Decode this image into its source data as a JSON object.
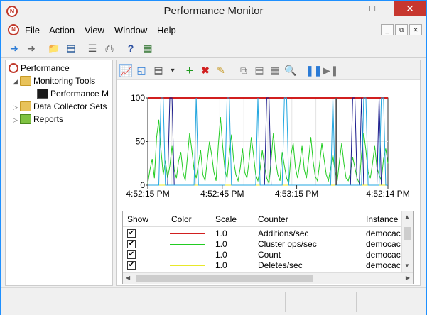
{
  "window": {
    "title": "Performance Monitor"
  },
  "menu": [
    "File",
    "Action",
    "View",
    "Window",
    "Help"
  ],
  "tree": [
    {
      "label": "Performance"
    },
    {
      "label": "Monitoring Tools"
    },
    {
      "label": "Performance M"
    },
    {
      "label": "Data Collector Sets"
    },
    {
      "label": "Reports"
    }
  ],
  "chart": {
    "yticks": [
      "100",
      "50",
      "0"
    ],
    "xticks": [
      "4:52:15 PM",
      "4:52:45 PM",
      "4:53:15 PM",
      "4:52:14 PM"
    ]
  },
  "chart_data": {
    "type": "line",
    "ylim": [
      0,
      100
    ],
    "yticks": [
      0,
      50,
      100
    ],
    "xticks": [
      "4:52:15 PM",
      "4:52:45 PM",
      "4:53:15 PM",
      "4:52:14 PM"
    ],
    "series": [
      {
        "name": "Additions/sec",
        "color": "#d11f1f",
        "values": [
          100,
          100,
          100,
          100,
          100,
          100,
          100,
          100,
          100,
          100,
          100,
          100,
          100,
          100,
          100,
          100,
          100,
          100,
          100,
          100,
          100,
          100,
          100,
          100,
          100,
          100,
          100,
          100,
          100,
          100,
          100,
          100,
          100,
          100,
          100,
          100,
          100,
          100,
          100,
          100,
          100,
          100,
          100,
          100,
          100,
          100,
          100,
          100,
          100,
          100,
          100,
          100,
          100,
          100,
          100,
          100,
          100,
          100,
          100,
          100,
          100,
          100,
          100,
          100,
          100,
          100,
          100,
          100,
          100,
          100,
          100,
          100,
          100,
          100,
          100,
          100,
          100,
          100,
          100,
          100,
          100,
          100,
          100,
          100,
          100,
          100,
          100,
          100,
          100,
          100,
          100,
          100,
          100,
          100,
          100,
          100,
          100,
          100,
          100,
          100,
          100,
          100,
          100,
          100,
          100,
          100,
          100,
          100,
          100,
          100
        ]
      },
      {
        "name": "Cluster ops/sec",
        "color": "#22cc22",
        "values": [
          2,
          18,
          30,
          8,
          55,
          75,
          40,
          12,
          28,
          8,
          22,
          45,
          18,
          8,
          28,
          38,
          15,
          5,
          32,
          60,
          40,
          18,
          8,
          25,
          40,
          12,
          5,
          28,
          50,
          35,
          15,
          5,
          45,
          78,
          45,
          18,
          8,
          35,
          58,
          28,
          12,
          5,
          20,
          42,
          15,
          8,
          28,
          55,
          35,
          12,
          5,
          18,
          40,
          22,
          8,
          2,
          30,
          60,
          28,
          12,
          5,
          38,
          22,
          8,
          2,
          35,
          48,
          20,
          8,
          25,
          45,
          18,
          8,
          30,
          55,
          28,
          10,
          5,
          25,
          48,
          30,
          12,
          5,
          20,
          35,
          15,
          5,
          28,
          48,
          25,
          8,
          5,
          15,
          32,
          20,
          8,
          2,
          35,
          60,
          40,
          15,
          8,
          25,
          45,
          20,
          12,
          5,
          30,
          42,
          25
        ]
      },
      {
        "name": "Count",
        "color": "#1a1a8c",
        "values": [
          0,
          0,
          0,
          0,
          0,
          0,
          0,
          0,
          0,
          0,
          100,
          100,
          0,
          0,
          0,
          0,
          0,
          0,
          0,
          0,
          0,
          0,
          0,
          0,
          0,
          0,
          0,
          0,
          0,
          0,
          0,
          0,
          0,
          0,
          0,
          0,
          0,
          0,
          0,
          0,
          0,
          0,
          0,
          0,
          0,
          0,
          0,
          0,
          0,
          0,
          0,
          0,
          0,
          0,
          100,
          100,
          0,
          0,
          0,
          0,
          0,
          0,
          0,
          0,
          0,
          0,
          0,
          0,
          0,
          0,
          0,
          0,
          0,
          0,
          0,
          0,
          0,
          0,
          0,
          0,
          0,
          0,
          0,
          0,
          0,
          0,
          0,
          0,
          0,
          0,
          0,
          0,
          0,
          100,
          100,
          0,
          0,
          100,
          0,
          0,
          0,
          0,
          0,
          0,
          0,
          100,
          0,
          0,
          0,
          0
        ]
      },
      {
        "name": "Deletes/sec",
        "color": "#e8e82a",
        "values": [
          0,
          0,
          0,
          0,
          0,
          0,
          0,
          0,
          0,
          0,
          0,
          0,
          0,
          0,
          0,
          0,
          0,
          0,
          0,
          0,
          0,
          0,
          0,
          0,
          0,
          0,
          0,
          0,
          0,
          0,
          0,
          0,
          0,
          0,
          0,
          0,
          0,
          0,
          0,
          0,
          0,
          0,
          0,
          0,
          0,
          0,
          0,
          0,
          0,
          0,
          0,
          0,
          0,
          0,
          0,
          0,
          0,
          0,
          0,
          0,
          0,
          0,
          0,
          0,
          0,
          0,
          0,
          0,
          0,
          0,
          0,
          0,
          0,
          0,
          0,
          0,
          0,
          0,
          0,
          0,
          0,
          0,
          0,
          0,
          0,
          0,
          0,
          0,
          0,
          0,
          0,
          0,
          0,
          0,
          0,
          0,
          0,
          0,
          0,
          0,
          0,
          0,
          0,
          0,
          0,
          0,
          0,
          0,
          0,
          0
        ]
      },
      {
        "name": "Instance",
        "color": "#23a7e0",
        "values": [
          0,
          0,
          0,
          0,
          0,
          0,
          100,
          100,
          0,
          0,
          0,
          0,
          0,
          0,
          0,
          0,
          0,
          0,
          0,
          0,
          0,
          0,
          100,
          0,
          0,
          0,
          0,
          0,
          0,
          0,
          0,
          0,
          0,
          0,
          0,
          0,
          100,
          100,
          0,
          0,
          0,
          0,
          0,
          0,
          0,
          0,
          0,
          0,
          0,
          0,
          100,
          0,
          0,
          0,
          0,
          0,
          0,
          0,
          0,
          0,
          0,
          0,
          100,
          100,
          0,
          0,
          0,
          0,
          0,
          0,
          0,
          0,
          0,
          0,
          0,
          0,
          0,
          0,
          0,
          0,
          0,
          0,
          0,
          0,
          100,
          0,
          0,
          0,
          0,
          0,
          0,
          0,
          0,
          0,
          0,
          0,
          0,
          0,
          100,
          100,
          0,
          0,
          0,
          0,
          0,
          0,
          100,
          100,
          0,
          0
        ]
      }
    ]
  },
  "legend": {
    "headers": {
      "show": "Show",
      "color": "Color",
      "scale": "Scale",
      "counter": "Counter",
      "instance": "Instance"
    },
    "rows": [
      {
        "show": "✔",
        "color": "#d11f1f",
        "scale": "1.0",
        "counter": "Additions/sec",
        "instance": "democac"
      },
      {
        "show": "✔",
        "color": "#22cc22",
        "scale": "1.0",
        "counter": "Cluster ops/sec",
        "instance": "democac"
      },
      {
        "show": "✔",
        "color": "#1a1a8c",
        "scale": "1.0",
        "counter": "Count",
        "instance": "democac"
      },
      {
        "show": "✔",
        "color": "#e8e82a",
        "scale": "1.0",
        "counter": "Deletes/sec",
        "instance": "democac"
      }
    ]
  }
}
